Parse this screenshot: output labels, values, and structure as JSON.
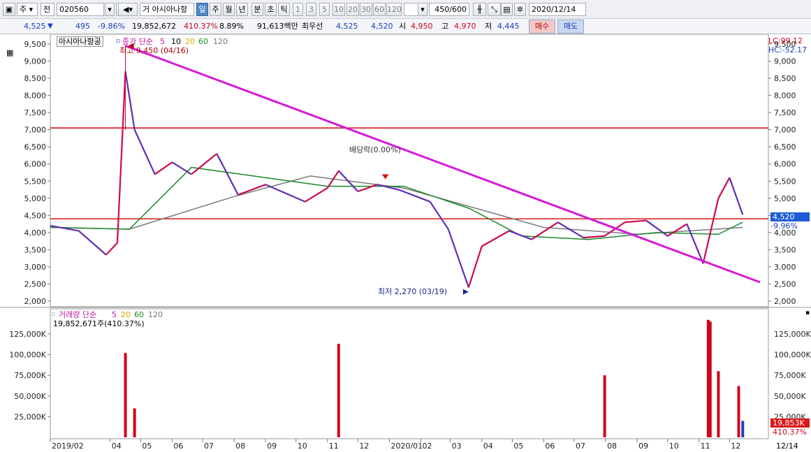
{
  "toolbar": {
    "market_select": "주",
    "market_select2": "전",
    "code": "020560",
    "name_prefix": "거",
    "name": "아시아나항",
    "period_buttons": [
      {
        "label": "일",
        "selected": true
      },
      {
        "label": "주",
        "selected": false
      },
      {
        "label": "월",
        "selected": false
      },
      {
        "label": "년",
        "selected": false
      },
      {
        "label": "분",
        "selected": false
      },
      {
        "label": "초",
        "selected": false
      },
      {
        "label": "틱",
        "selected": false
      }
    ],
    "interval_buttons": [
      "1",
      "3",
      "5",
      "10",
      "20",
      "30",
      "60",
      "120"
    ],
    "count": "450",
    "count_total": "/600",
    "date": "2020/12/14"
  },
  "quote": {
    "price": "4,525",
    "change_arrow": "▼",
    "change": "495",
    "change_pct": "-9.86%",
    "volume": "19,852,672",
    "volume_ratio": "410.37%",
    "turnover": "8.89%",
    "amount": "91,613백만",
    "best_ask_label": "최우선",
    "best_ask": "4,525",
    "best_bid": "4,520",
    "open_label": "시",
    "open": "4,950",
    "high_label": "고",
    "high": "4,970",
    "low_label": "저",
    "low": "4,445",
    "buy_button": "매수",
    "sell_button": "매도"
  },
  "price_panel": {
    "title": "아시아나항공",
    "legend": [
      {
        "label": "종가 단순",
        "color": "#c0149e"
      },
      {
        "label": "5",
        "color": "#c0149e"
      },
      {
        "label": "10",
        "color": "#000000"
      },
      {
        "label": "20",
        "color": "#d8a800"
      },
      {
        "label": "60",
        "color": "#1a8a2a"
      },
      {
        "label": "120",
        "color": "#7a7a7a"
      }
    ],
    "lc_label": "LC:99.12",
    "hc_label": "HC:-52.17",
    "high_marker": "최고 9,450 (04/16)",
    "low_marker": "최저 2,270 (03/19)",
    "dividend_marker": "배당락(0.00%)",
    "current_price_tag": "4,520",
    "current_change_tag": "-9.96%",
    "y_ticks": [
      "9,500",
      "9,000",
      "8,500",
      "8,000",
      "7,500",
      "7,000",
      "6,500",
      "6,000",
      "5,500",
      "5,000",
      "4,500",
      "4,000",
      "3,500",
      "3,000",
      "2,500",
      "2,000"
    ]
  },
  "volume_panel": {
    "legend": [
      {
        "label": "거래량 단순",
        "color": "#c0149e"
      },
      {
        "label": "5",
        "color": "#c0149e"
      },
      {
        "label": "20",
        "color": "#d8a800"
      },
      {
        "label": "60",
        "color": "#1a8a2a"
      },
      {
        "label": "120",
        "color": "#7a7a7a"
      }
    ],
    "summary": "19,852,671주(410.37%)",
    "current_volume_tag": "19,853K",
    "current_ratio_tag": "410.37%",
    "y_ticks": [
      "125,000K",
      "100,000K",
      "75,000K",
      "50,000K",
      "25,000K"
    ]
  },
  "x_axis": {
    "ticks": [
      "2019/02",
      "04",
      "05",
      "06",
      "07",
      "08",
      "09",
      "10",
      "11",
      "12",
      "2020/01",
      "02",
      "03",
      "04",
      "05",
      "06",
      "07",
      "08",
      "09",
      "10",
      "11",
      "12"
    ],
    "right_label": "12/14"
  },
  "chart_data": {
    "type": "line",
    "title": "아시아나항공",
    "y_range": [
      2000,
      9700
    ],
    "horizontal_lines": [
      7050,
      4400
    ],
    "trendline": {
      "from": {
        "date": "2019/04/16",
        "price": 9450
      },
      "to": {
        "date": "2020/12/31",
        "price": 2550
      }
    },
    "close_series": {
      "name": "종가",
      "dates": [
        "2019/02/01",
        "2019/03/01",
        "2019/03/28",
        "2019/04/08",
        "2019/04/16",
        "2019/04/25",
        "2019/05/15",
        "2019/06/01",
        "2019/06/20",
        "2019/07/15",
        "2019/08/05",
        "2019/09/01",
        "2019/10/10",
        "2019/11/01",
        "2019/11/12",
        "2019/12/01",
        "2019/12/20",
        "2020/01/10",
        "2020/02/10",
        "2020/02/28",
        "2020/03/19",
        "2020/04/01",
        "2020/04/28",
        "2020/05/20",
        "2020/06/15",
        "2020/07/10",
        "2020/07/31",
        "2020/08/20",
        "2020/09/10",
        "2020/10/01",
        "2020/10/20",
        "2020/11/05",
        "2020/11/20",
        "2020/12/01",
        "2020/12/14"
      ],
      "values": [
        4200,
        4050,
        3350,
        3700,
        8700,
        7000,
        5700,
        6050,
        5700,
        6300,
        5100,
        5400,
        4900,
        5300,
        5800,
        5200,
        5400,
        5250,
        4900,
        4100,
        2400,
        3600,
        4050,
        3800,
        4300,
        3850,
        3900,
        4300,
        4350,
        3900,
        4250,
        3100,
        5000,
        5600,
        4520
      ]
    },
    "ma120": {
      "name": "120",
      "dates": [
        "2019/02/01",
        "2019/04/20",
        "2019/08/01",
        "2019/10/15",
        "2020/01/15",
        "2020/03/15",
        "2020/06/01",
        "2020/09/01",
        "2020/12/14"
      ],
      "values": [
        4150,
        4100,
        5050,
        5650,
        5300,
        4800,
        4150,
        3950,
        4150
      ]
    },
    "ma60": {
      "name": "60",
      "dates": [
        "2019/02/01",
        "2019/04/20",
        "2019/06/20",
        "2019/08/20",
        "2019/11/01",
        "2020/01/15",
        "2020/03/20",
        "2020/05/10",
        "2020/07/15",
        "2020/09/20",
        "2020/11/20",
        "2020/12/14"
      ],
      "values": [
        4150,
        4100,
        5900,
        5650,
        5350,
        5350,
        4700,
        3900,
        3800,
        4000,
        3950,
        4300
      ]
    },
    "volume_series": {
      "name": "거래량",
      "unit": "K",
      "dates": [
        "2019/04/16",
        "2019/04/25",
        "2019/11/12",
        "2020/07/31",
        "2020/11/10",
        "2020/11/12",
        "2020/11/20",
        "2020/12/10",
        "2020/12/14"
      ],
      "values": [
        102000,
        35000,
        113000,
        75000,
        142000,
        140000,
        80000,
        62000,
        19853
      ]
    }
  },
  "colors": {
    "up": "#d0021b",
    "down": "#1a3fbf",
    "trendline": "#d61ad6",
    "hline": "#d81818",
    "ma5": "#c0149e",
    "ma20": "#d8a800",
    "ma60": "#1a8a2a",
    "ma120": "#7a7a7a"
  }
}
